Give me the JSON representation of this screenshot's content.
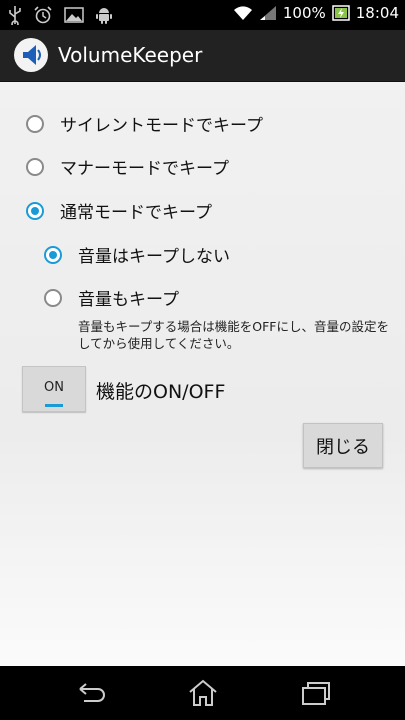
{
  "status_bar": {
    "battery": "100%",
    "time": "18:04",
    "icons": [
      "usb-icon",
      "alarm-icon",
      "image-icon",
      "android-icon",
      "wifi-icon",
      "signal-icon",
      "battery-icon"
    ]
  },
  "app_bar": {
    "title": "VolumeKeeper",
    "icon": "speaker-app-icon"
  },
  "modes": [
    {
      "label": "サイレントモードでキープ",
      "checked": false
    },
    {
      "label": "マナーモードでキープ",
      "checked": false
    },
    {
      "label": "通常モードでキープ",
      "checked": true
    }
  ],
  "sub_options": [
    {
      "label": "音量はキープしない",
      "checked": true
    },
    {
      "label": "音量もキープ",
      "checked": false
    }
  ],
  "note": "音量もキープする場合は機能をOFFにし、音量の設定をしてから使用してください。",
  "toggle": {
    "state_label": "ON",
    "label": "機能のON/OFF",
    "on": true
  },
  "close_button": "閉じる",
  "nav": [
    "back-icon",
    "home-icon",
    "recent-apps-icon"
  ],
  "colors": {
    "accent": "#1a9bd7",
    "background": "#f1f1f1",
    "action_bar": "#222222"
  }
}
